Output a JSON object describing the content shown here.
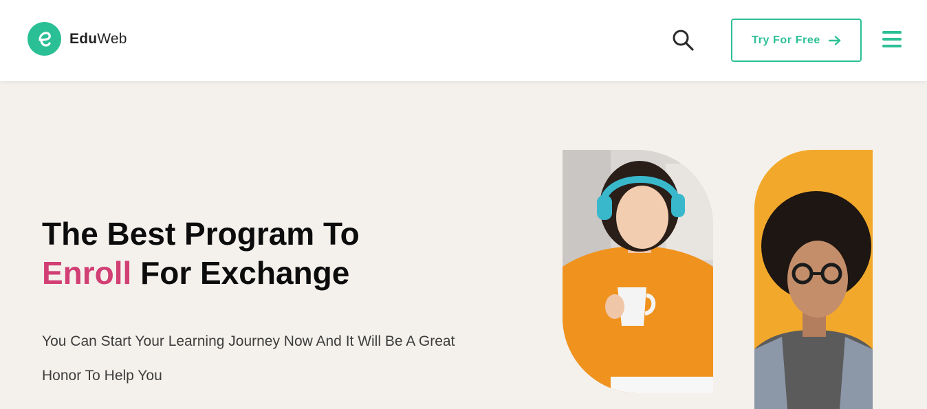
{
  "brand": {
    "name_bold": "Edu",
    "name_regular": "Web",
    "color": "#2bbf95"
  },
  "header": {
    "search_icon": "search-icon",
    "cta_label": "Try For Free",
    "cta_icon": "arrow-right-icon",
    "menu_icon": "hamburger-menu-icon"
  },
  "hero": {
    "title_line1": "The Best Program To",
    "title_accent": "Enroll",
    "title_rest": "For Exchange",
    "subtitle": "You Can Start Your Learning Journey Now And It Will Be A Great Honor To Help You",
    "accent_color": "#d13f74"
  },
  "images": [
    {
      "label": "student-with-headphones-photo"
    },
    {
      "label": "student-curly-hair-photo"
    }
  ]
}
